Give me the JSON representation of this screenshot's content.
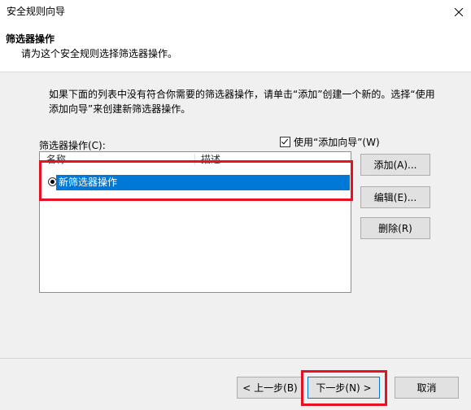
{
  "window": {
    "title": "安全规则向导"
  },
  "header": {
    "title": "筛选器操作",
    "subtitle": "请为这个安全规则选择筛选器操作。"
  },
  "instructions": {
    "line1": "如果下面的列表中没有符合你需要的筛选器操作，请单击“添加”创建一个新的。选择“使用",
    "line2": "添加向导”来创建新筛选器操作。"
  },
  "filter_list": {
    "label": "筛选器操作(C):",
    "use_wizard_label": "使用“添加向导”(W)",
    "use_wizard_checked": true,
    "columns": [
      "名称",
      "描述"
    ],
    "rows": [
      {
        "name": "新筛选器操作",
        "description": "",
        "selected": true
      }
    ]
  },
  "side_buttons": {
    "add": "添加(A)...",
    "edit": "编辑(E)...",
    "remove": "删除(R)"
  },
  "footer": {
    "back": "< 上一步(B)",
    "next": "下一步(N) >",
    "cancel": "取消"
  },
  "colors": {
    "selection": "#0078d7",
    "highlight": "#e81123"
  },
  "icons": {
    "close": "close-icon",
    "radio": "radio-selected-icon",
    "checkbox": "checkbox-checked-icon"
  }
}
